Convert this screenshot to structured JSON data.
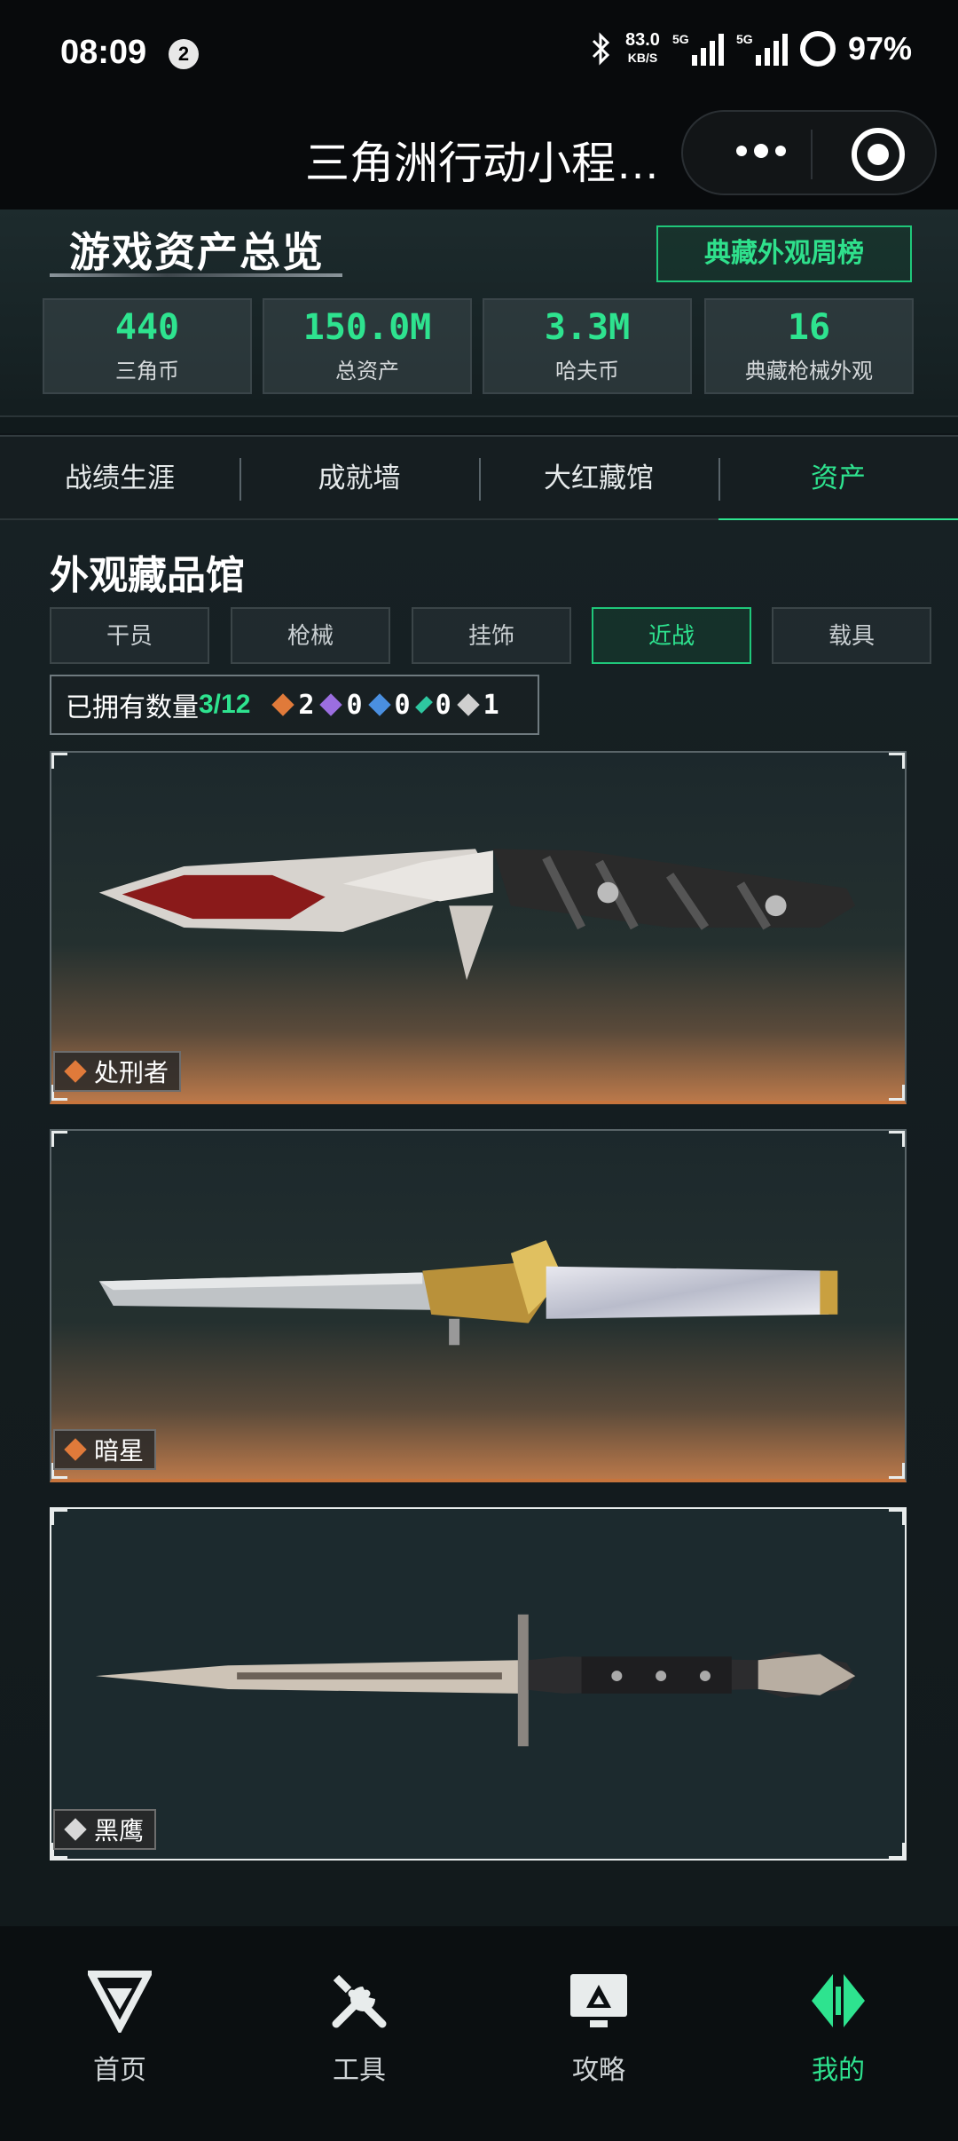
{
  "status": {
    "time": "08:09",
    "notification_count": "2",
    "net_speed": "83.0",
    "net_unit": "KB/S",
    "signal1": "5G",
    "signal2": "5G",
    "battery": "97%"
  },
  "titlebar": {
    "title": "三角洲行动小程…"
  },
  "overview": {
    "title": "游戏资产总览",
    "rank_button": "典藏外观周榜",
    "stats": [
      {
        "value": "440",
        "label": "三角币"
      },
      {
        "value": "150.0M",
        "label": "总资产"
      },
      {
        "value": "3.3M",
        "label": "哈夫币"
      },
      {
        "value": "16",
        "label": "典藏枪械外观"
      }
    ]
  },
  "tabs": [
    {
      "label": "战绩生涯",
      "active": false
    },
    {
      "label": "成就墙",
      "active": false
    },
    {
      "label": "大红藏馆",
      "active": false
    },
    {
      "label": "资产",
      "active": true
    }
  ],
  "gallery": {
    "title": "外观藏品馆",
    "filters": [
      {
        "label": "干员",
        "active": false
      },
      {
        "label": "枪械",
        "active": false
      },
      {
        "label": "挂饰",
        "active": false
      },
      {
        "label": "近战",
        "active": true
      },
      {
        "label": "载具",
        "active": false
      }
    ],
    "owned_label": "已拥有数量",
    "owned_count": "3/12",
    "rarity_counts": [
      {
        "color": "#e07a3a",
        "count": "2"
      },
      {
        "color": "#9b6ee0",
        "count": "0"
      },
      {
        "color": "#4a8fe0",
        "count": "0"
      },
      {
        "color": "#2ec7a0",
        "count": "0"
      },
      {
        "color": "#cfcfcf",
        "count": "1"
      }
    ],
    "items": [
      {
        "name": "处刑者",
        "rarity_color": "#e07a3a"
      },
      {
        "name": "暗星",
        "rarity_color": "#e07a3a"
      },
      {
        "name": "黑鹰",
        "rarity_color": "#d8d8d8"
      }
    ]
  },
  "bottom_nav": [
    {
      "label": "首页",
      "icon": "home-logo-icon",
      "active": false
    },
    {
      "label": "工具",
      "icon": "tools-icon",
      "active": false
    },
    {
      "label": "攻略",
      "icon": "guide-monitor-icon",
      "active": false
    },
    {
      "label": "我的",
      "icon": "profile-logo-icon",
      "active": true
    }
  ],
  "colors": {
    "accent": "#2ee38f",
    "rarity_orange": "#e07a3a"
  }
}
